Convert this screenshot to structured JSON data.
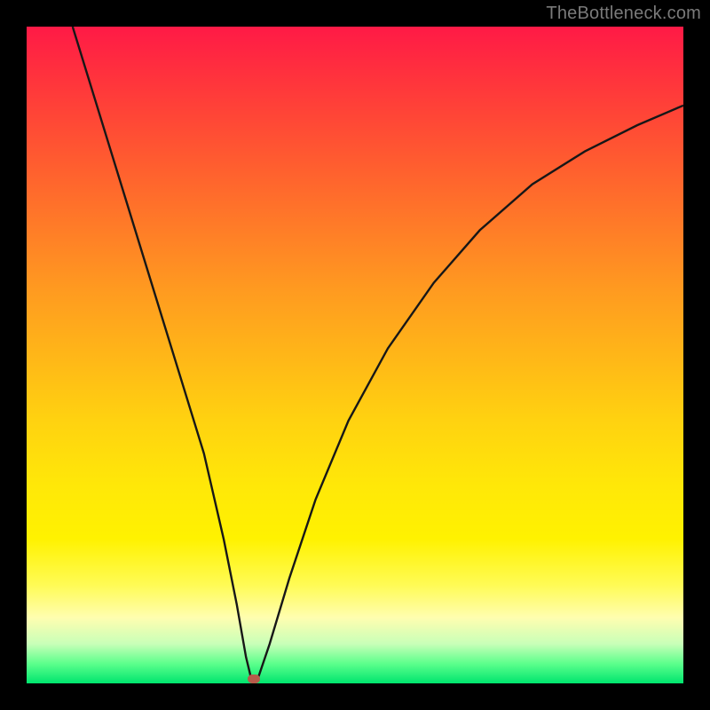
{
  "watermark": "TheBottleneck.com",
  "chart_data": {
    "type": "line",
    "title": "",
    "xlabel": "",
    "ylabel": "",
    "xlim": [
      0,
      100
    ],
    "ylim": [
      0,
      100
    ],
    "grid": false,
    "series": [
      {
        "name": "curve",
        "x": [
          7,
          11,
          15,
          19,
          23,
          27,
          30,
          32,
          33.4,
          34.2,
          35.2,
          37,
          40,
          44,
          49,
          55,
          62,
          69,
          77,
          85,
          93,
          100
        ],
        "y": [
          100,
          87,
          74,
          61,
          48,
          35,
          22,
          12,
          4,
          0.7,
          0.7,
          6,
          16,
          28,
          40,
          51,
          61,
          69,
          76,
          81,
          85,
          88
        ]
      }
    ],
    "marker": {
      "x": 34.6,
      "y": 0.7
    },
    "gradient_stops": [
      {
        "pos": 0,
        "color": "#ff1a46"
      },
      {
        "pos": 50,
        "color": "#ffb618"
      },
      {
        "pos": 78,
        "color": "#fff200"
      },
      {
        "pos": 100,
        "color": "#00e56e"
      }
    ]
  }
}
